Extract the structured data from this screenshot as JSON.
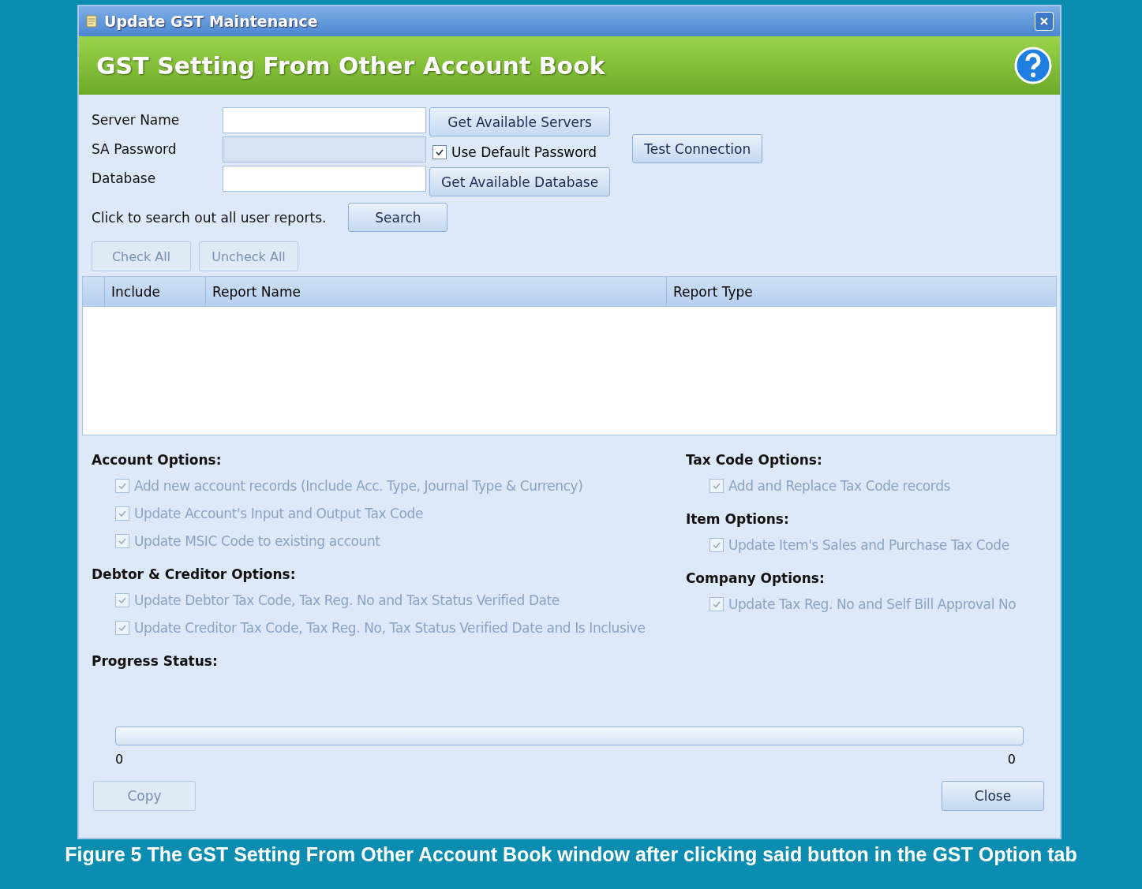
{
  "window": {
    "title": "Update GST Maintenance"
  },
  "header": {
    "title": "GST Setting From Other Account Book"
  },
  "connection": {
    "fields": [
      {
        "label": "Server Name",
        "disabled": false
      },
      {
        "label": "SA Password",
        "disabled": true
      },
      {
        "label": "Database",
        "disabled": false
      }
    ],
    "get_servers_button": "Get Available Servers",
    "default_password": {
      "label": "Use Default Password",
      "checked": true
    },
    "test_button": "Test Connection",
    "get_database_button": "Get Available Database"
  },
  "search": {
    "hint": "Click to search out all user reports.",
    "button": "Search"
  },
  "list_buttons": [
    {
      "label": "Check All",
      "disabled": true
    },
    {
      "label": "Uncheck All",
      "disabled": true
    }
  ],
  "table": {
    "columns": [
      "Include",
      "Report Name",
      "Report Type"
    ]
  },
  "option_columns": [
    [
      {
        "title": "Account Options:",
        "items": [
          {
            "label": "Add new account records (Include Acc. Type, Journal Type & Currency)",
            "checked": true,
            "disabled": true
          },
          {
            "label": "Update Account's Input and Output Tax Code",
            "checked": true,
            "disabled": true
          },
          {
            "label": "Update MSIC Code to existing account",
            "checked": true,
            "disabled": true
          }
        ]
      },
      {
        "title": "Debtor & Creditor Options:",
        "items": [
          {
            "label": "Update Debtor Tax Code, Tax Reg. No and Tax Status Verified Date",
            "checked": true,
            "disabled": true
          },
          {
            "label": "Update Creditor Tax Code, Tax Reg. No, Tax Status Verified Date and Is Inclusive",
            "checked": true,
            "disabled": true
          }
        ]
      }
    ],
    [
      {
        "title": "Tax Code Options:",
        "items": [
          {
            "label": "Add and Replace Tax Code records",
            "checked": true,
            "disabled": true
          }
        ]
      },
      {
        "title": "Item Options:",
        "items": [
          {
            "label": "Update Item's Sales and Purchase Tax Code",
            "checked": true,
            "disabled": true
          }
        ]
      },
      {
        "title": "Company Options:",
        "items": [
          {
            "label": "Update Tax Reg. No and Self Bill Approval No",
            "checked": true,
            "disabled": true
          }
        ]
      }
    ]
  ],
  "progress": {
    "title": "Progress Status:",
    "level": 0,
    "min_label": "0",
    "max_label": "0"
  },
  "footer_buttons": [
    {
      "label": "Copy",
      "disabled": true
    },
    {
      "label": "Close",
      "disabled": false
    }
  ],
  "caption": "Figure 5 The GST Setting From Other Account Book window after clicking said button in the GST Option tab"
}
